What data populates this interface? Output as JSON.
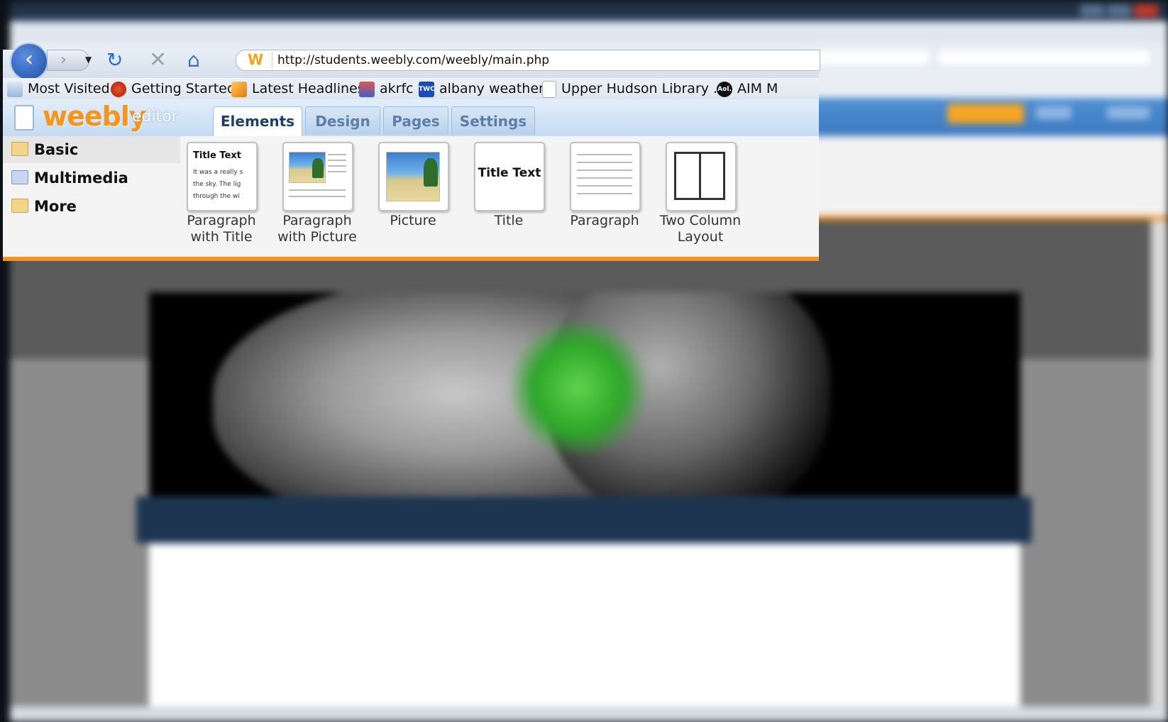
{
  "browser": {
    "url": "http://students.weebly.com/weebly/main.php",
    "bookmarks": [
      {
        "label": "Most Visited",
        "icon": "most-visited-icon"
      },
      {
        "label": "Getting Started",
        "icon": "firefox-icon"
      },
      {
        "label": "Latest Headlines",
        "icon": "rss-icon"
      },
      {
        "label": "akrfc",
        "icon": "akrfc-icon"
      },
      {
        "label": "albany weather",
        "icon": "twc-icon"
      },
      {
        "label": "Upper Hudson Library ...",
        "icon": "page-icon"
      },
      {
        "label": "AIM M",
        "icon": "aol-icon"
      }
    ],
    "twc_icon_text": "TWC",
    "aol_icon_text": "Aol."
  },
  "weebly": {
    "logo": "weebly",
    "editor_label": "editor",
    "tabs": [
      "Elements",
      "Design",
      "Pages",
      "Settings"
    ],
    "active_tab": "Elements",
    "categories": [
      "Basic",
      "Multimedia",
      "More"
    ],
    "elements": [
      {
        "label_line1": "Paragraph",
        "label_line2": "with Title"
      },
      {
        "label_line1": "Paragraph",
        "label_line2": "with Picture"
      },
      {
        "label_line1": "Picture",
        "label_line2": ""
      },
      {
        "label_line1": "Title",
        "label_line2": ""
      },
      {
        "label_line1": "Paragraph",
        "label_line2": ""
      },
      {
        "label_line1": "Two Column",
        "label_line2": "Layout"
      }
    ],
    "thumb_para_title": {
      "title": "Title Text",
      "lines": [
        "It was a really s",
        "the sky.  The lig",
        "through the wi"
      ]
    },
    "thumb_title_text": "Title Text"
  },
  "colors": {
    "accent_orange": "#f39422",
    "logo_orange": "#f7931e",
    "tab_text": "#1b3f6d"
  }
}
